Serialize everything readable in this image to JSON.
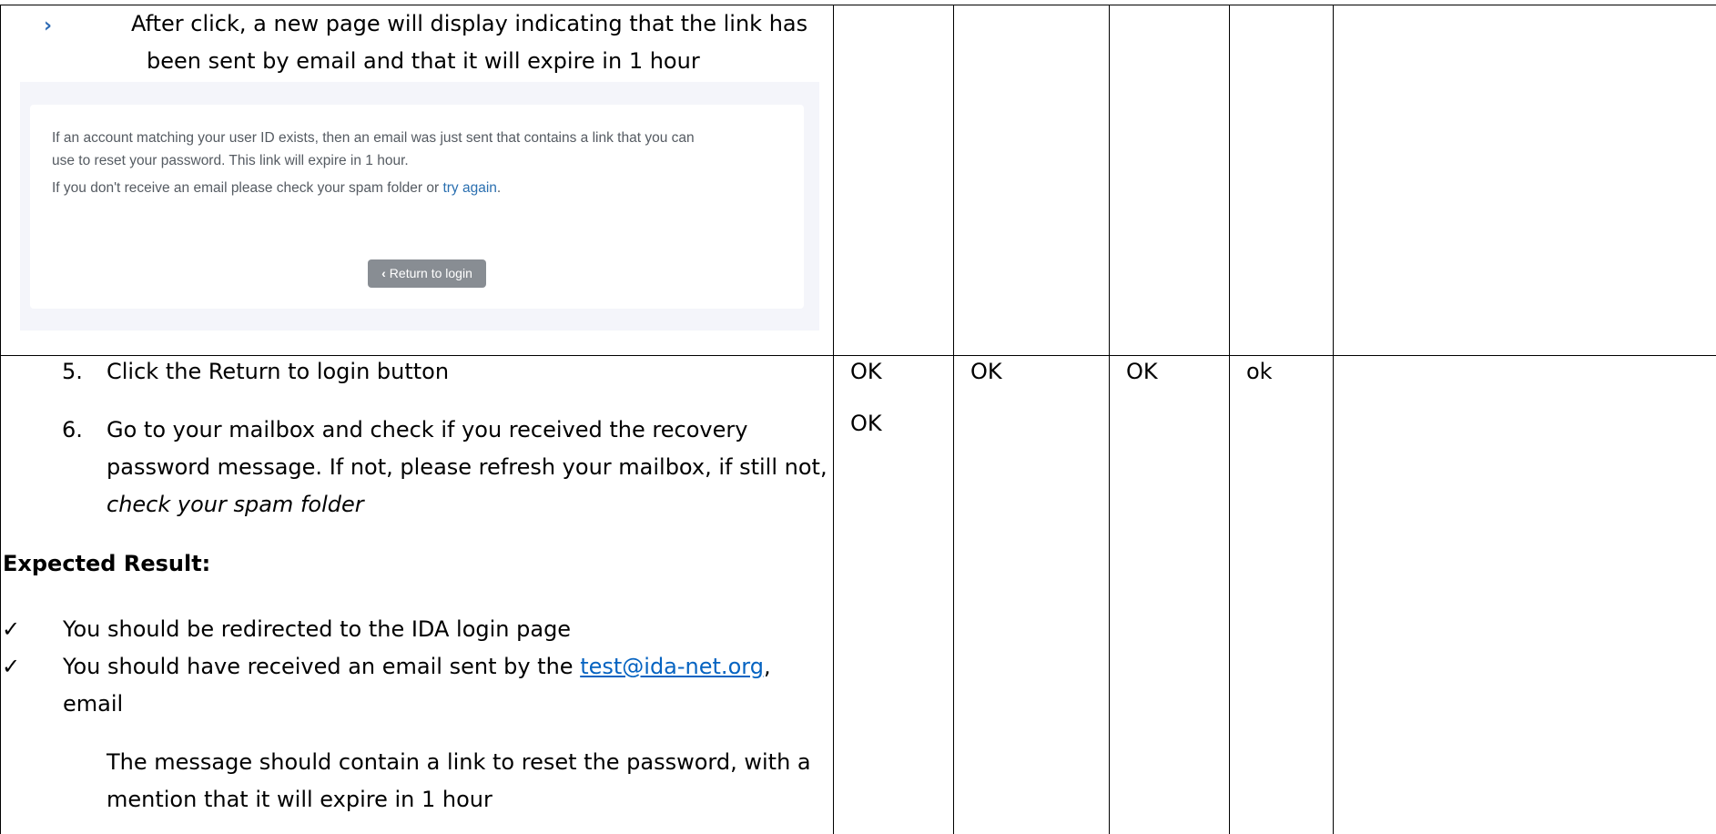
{
  "top_cell": {
    "bullet_icon": "chevron-right-icon",
    "caption_line1": "After click, a new page will display indicating that the link has",
    "caption_line2": "been sent by email and that it will expire in 1 hour",
    "screenshot": {
      "message_line1": "If an account matching your user ID exists, then an email was just sent that contains a link that you can",
      "message_line2": "use to reset your password. This link will expire in 1 hour.",
      "spam_prefix": "If you don't receive an email please check your spam folder or ",
      "try_again_link": "try again",
      "spam_suffix": ".",
      "return_button": "Return to login",
      "return_icon": "chevron-left-icon"
    }
  },
  "steps": [
    {
      "number": "5.",
      "text": "Click the Return to login button"
    },
    {
      "number": "6.",
      "line1": "Go to your mailbox and check if you received the recovery",
      "line2": "password message. If not, please refresh your mailbox, if still not,",
      "line3": "check your spam folder"
    }
  ],
  "expected": {
    "heading": "Expected Result:",
    "check_icon": "checkmark-icon",
    "item1": "You should be redirected to the IDA login page",
    "item2_prefix": "You should have received an email sent by the ",
    "item2_email": "test@ida-net.org",
    "item2_suffix": ",",
    "item2_line2": "email",
    "note_line1": "The message should contain a link to reset the password, with a",
    "note_line2": "mention that it will expire in 1 hour"
  },
  "results": {
    "col1": [
      "OK",
      "OK"
    ],
    "col2": "OK",
    "col3": "OK",
    "col4": "ok"
  }
}
